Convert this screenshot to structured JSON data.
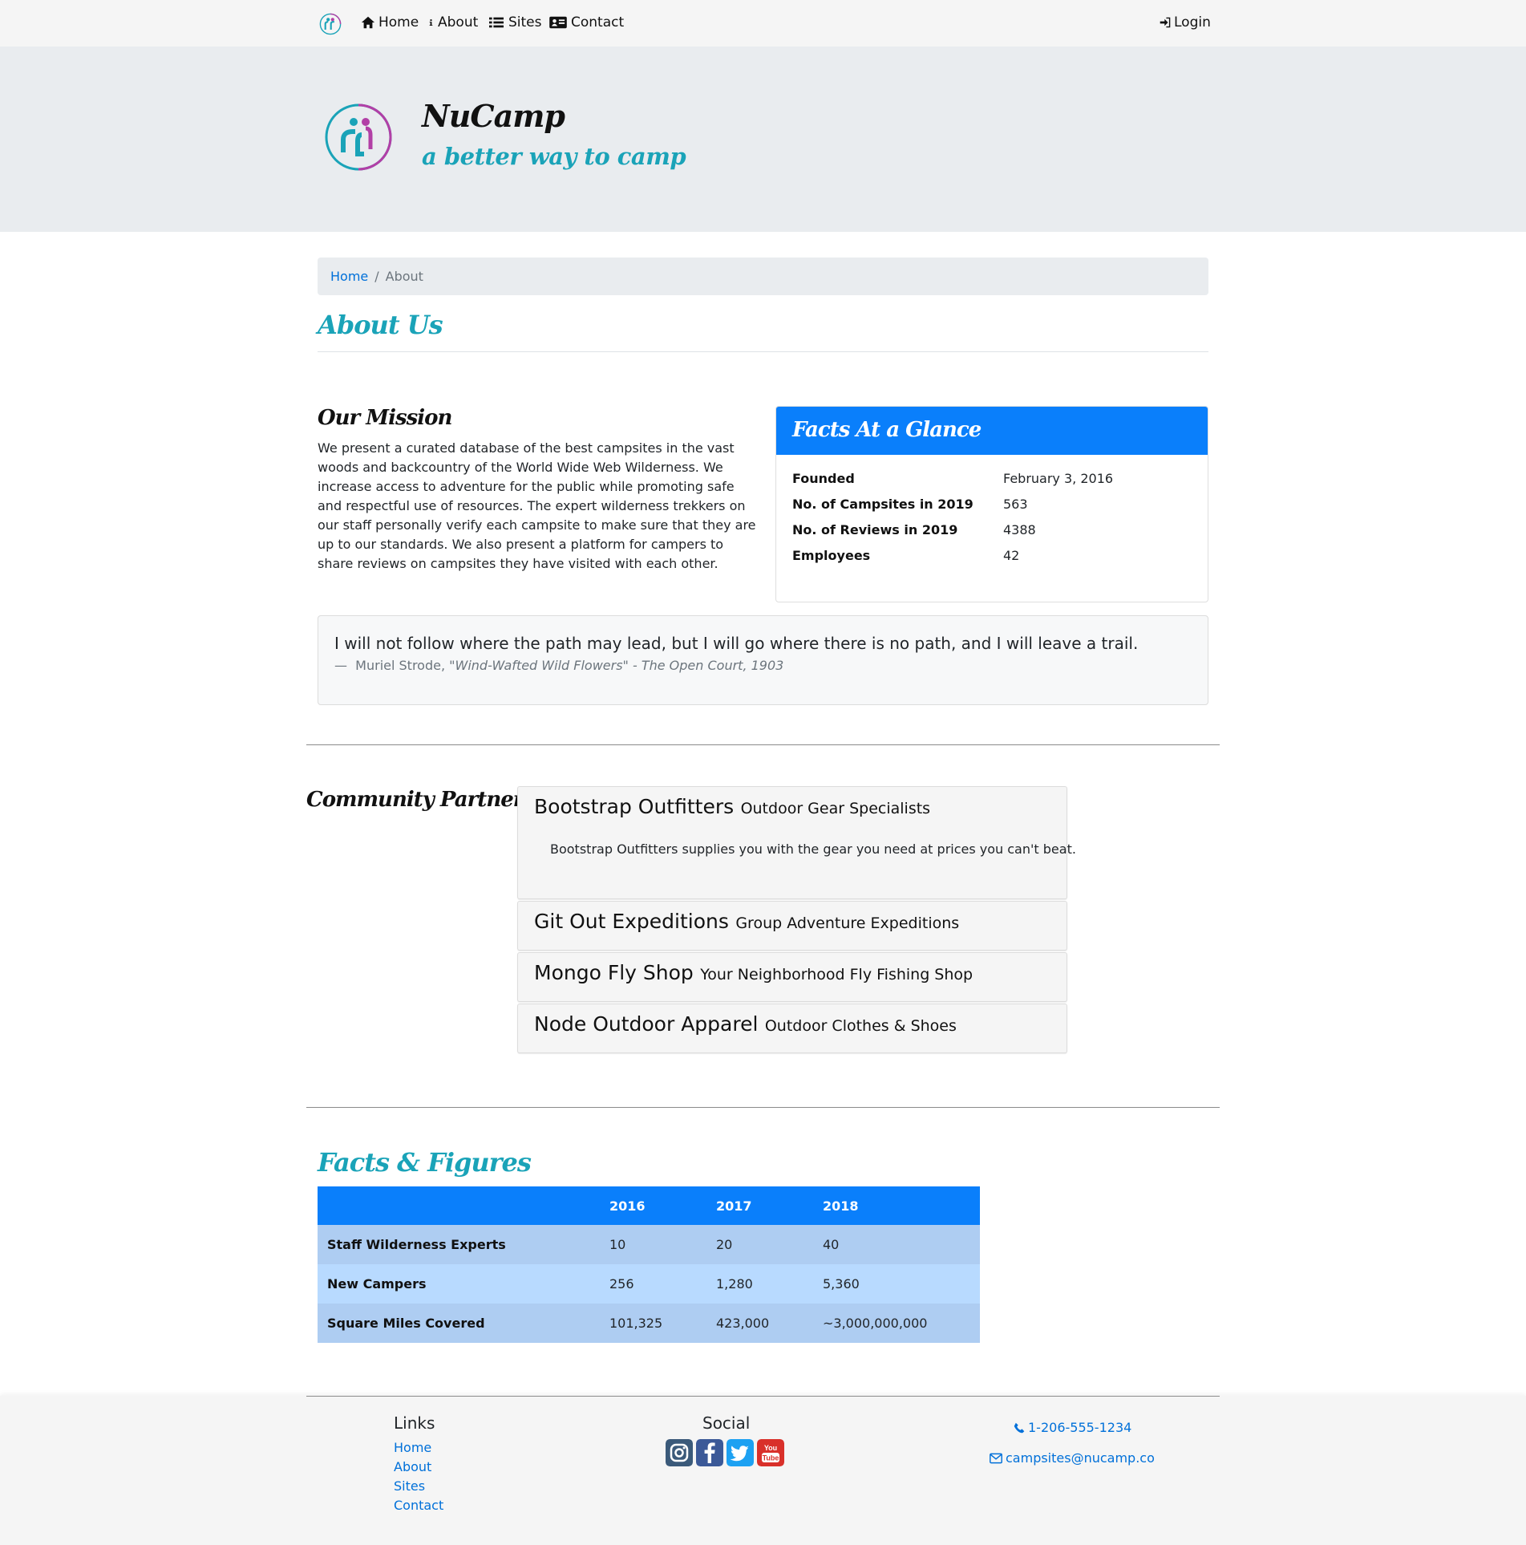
{
  "nav": {
    "items": [
      {
        "label": "Home",
        "icon": "home-icon"
      },
      {
        "label": "About",
        "icon": "info-icon"
      },
      {
        "label": "Sites",
        "icon": "list-icon"
      },
      {
        "label": "Contact",
        "icon": "address-card-icon"
      }
    ],
    "login_label": "Login"
  },
  "jumbotron": {
    "title": "NuCamp",
    "subtitle": "a better way to camp"
  },
  "breadcrumb": {
    "home": "Home",
    "separator": "/",
    "active": "About"
  },
  "page_title": "About Us",
  "mission": {
    "title": "Our Mission",
    "text": "We present a curated database of the best campsites in the vast woods and backcountry of the World Wide Web Wilderness. We increase access to adventure for the public while promoting safe and respectful use of resources. The expert wilderness trekkers on our staff personally verify each campsite to make sure that they are up to our standards. We also present a platform for campers to share reviews on campsites they have visited with each other."
  },
  "facts": {
    "title": "Facts At a Glance",
    "rows": [
      {
        "key": "Founded",
        "value": "February 3, 2016"
      },
      {
        "key": "No. of Campsites in 2019",
        "value": "563"
      },
      {
        "key": "No. of Reviews in 2019",
        "value": "4388"
      },
      {
        "key": "Employees",
        "value": "42"
      }
    ]
  },
  "quote": {
    "text": "I will not follow where the path may lead, but I will go where there is no path, and I will leave a trail.",
    "dash": "—",
    "author": "Muriel Strode,",
    "cite": "\"Wind-Wafted Wild Flowers\" - The Open Court, 1903"
  },
  "partners": {
    "title": "Community Partners",
    "items": [
      {
        "name": "Bootstrap Outfitters",
        "tagline": "Outdoor Gear Specialists",
        "body": "Bootstrap Outfitters supplies you with the gear you need at prices you can't beat."
      },
      {
        "name": "Git Out Expeditions",
        "tagline": "Group Adventure Expeditions"
      },
      {
        "name": "Mongo Fly Shop",
        "tagline": "Your Neighborhood Fly Fishing Shop"
      },
      {
        "name": "Node Outdoor Apparel",
        "tagline": "Outdoor Clothes & Shoes"
      }
    ]
  },
  "figures": {
    "title": "Facts & Figures",
    "columns": [
      "",
      "2016",
      "2017",
      "2018"
    ],
    "rows": [
      [
        "Staff Wilderness Experts",
        "10",
        "20",
        "40"
      ],
      [
        "New Campers",
        "256",
        "1,280",
        "5,360"
      ],
      [
        "Square Miles Covered",
        "101,325",
        "423,000",
        "~3,000,000,000"
      ]
    ]
  },
  "footer": {
    "links_title": "Links",
    "links": [
      "Home",
      "About",
      "Sites",
      "Contact"
    ],
    "social_title": "Social",
    "social": [
      "instagram-icon",
      "facebook-icon",
      "twitter-icon",
      "youtube-icon"
    ],
    "phone": "1-206-555-1234",
    "email": "campsites@nucamp.co"
  },
  "colors": {
    "primary": "#0a7ffb",
    "teal": "#1aa3b8",
    "link": "#0070d9",
    "magenta": "#b23fa6"
  }
}
